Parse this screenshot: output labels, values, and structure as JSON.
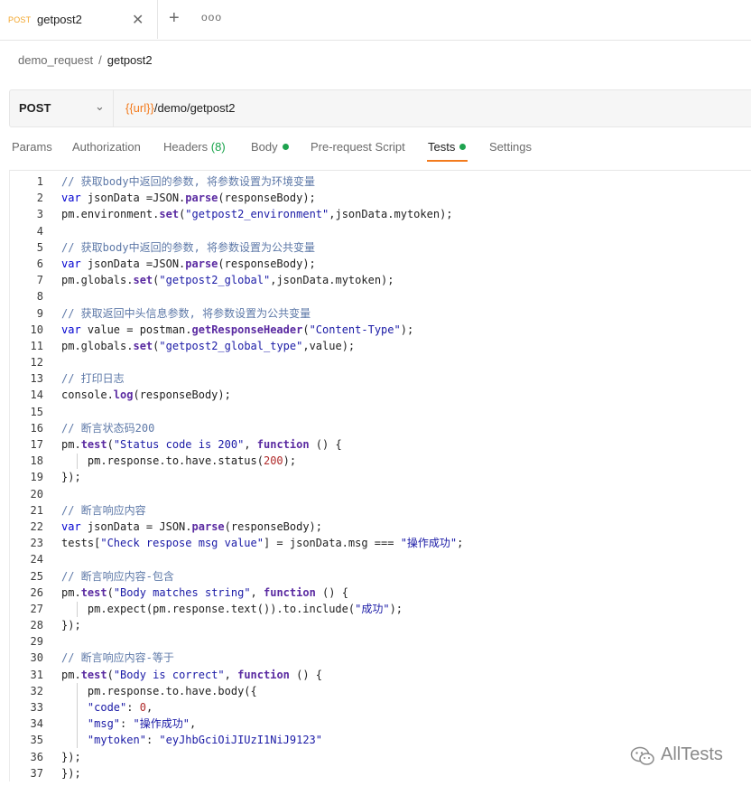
{
  "tab": {
    "method": "POST",
    "name": "getpost2"
  },
  "breadcrumb": {
    "collection": "demo_request",
    "separator": "/",
    "request": "getpost2"
  },
  "request": {
    "method": "POST",
    "url_variable": "{{url}}",
    "url_path": "/demo/getpost2"
  },
  "request_tabs": {
    "params": "Params",
    "authorization": "Authorization",
    "headers_label": "Headers",
    "headers_count": "(8)",
    "body": "Body",
    "prerequest": "Pre-request Script",
    "tests": "Tests",
    "settings": "Settings",
    "active": "Tests"
  },
  "code_lines": [
    "// 获取body中返回的参数, 将参数设置为环境变量",
    "var jsonData =JSON.parse(responseBody);",
    "pm.environment.set(\"getpost2_environment\",jsonData.mytoken);",
    "",
    "// 获取body中返回的参数, 将参数设置为公共变量",
    "var jsonData =JSON.parse(responseBody);",
    "pm.globals.set(\"getpost2_global\",jsonData.mytoken);",
    "",
    "// 获取返回中头信息参数, 将参数设置为公共变量",
    "var value = postman.getResponseHeader(\"Content-Type\");",
    "pm.globals.set(\"getpost2_global_type\",value);",
    "",
    "// 打印日志",
    "console.log(responseBody);",
    "",
    "// 断言状态码200",
    "pm.test(\"Status code is 200\", function () {",
    "    pm.response.to.have.status(200);",
    "});",
    "",
    "// 断言响应内容",
    "var jsonData = JSON.parse(responseBody);",
    "tests[\"Check respose msg value\"] = jsonData.msg === \"操作成功\";",
    "",
    "// 断言响应内容-包含",
    "pm.test(\"Body matches string\", function () {",
    "    pm.expect(pm.response.text()).to.include(\"成功\");",
    "});",
    "",
    "// 断言响应内容-等于",
    "pm.test(\"Body is correct\", function () {",
    "    pm.response.to.have.body({",
    "    \"code\": 0,",
    "    \"msg\": \"操作成功\",",
    "    \"mytoken\": \"eyJhbGciOiJIUzI1NiJ9123\"",
    "});",
    "});"
  ],
  "watermark": {
    "text": "AllTests",
    "icon": "wechat-icon"
  },
  "colors": {
    "accent": "#f37b1d",
    "method_post": "#f3a62b",
    "active_dot": "#1ea34f"
  }
}
